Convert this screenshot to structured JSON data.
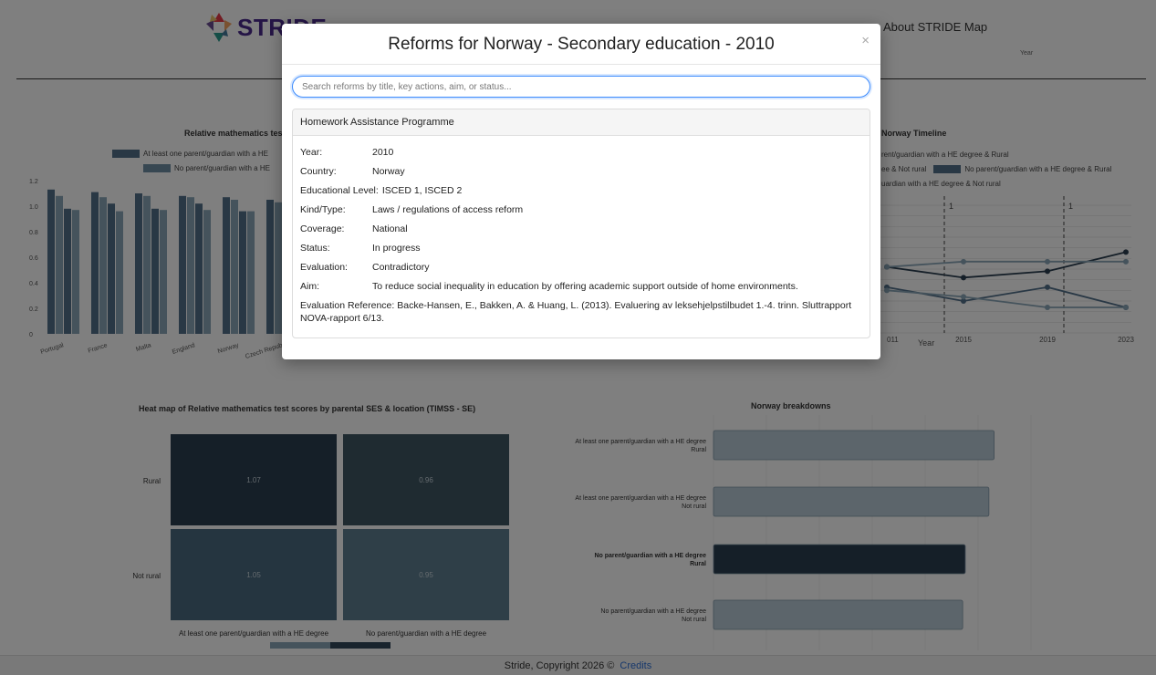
{
  "header": {
    "logo_text": "STRIDE",
    "nav_about": "About STRIDE Map",
    "year_label": "Year"
  },
  "bar_chart": {
    "title": "Relative mathematics test",
    "legend": [
      "At least one parent/guardian with a HE",
      "No parent/guardian with a HE"
    ],
    "yticks": [
      "1.2",
      "1.0",
      "0.8",
      "0.6",
      "0.4",
      "0.2",
      "0"
    ],
    "countries": [
      "Portugal",
      "France",
      "Malta",
      "England",
      "Norway",
      "Czech Repub"
    ]
  },
  "timeline_chart": {
    "title": "Norway Timeline",
    "legend": [
      "rent/guardian with a HE degree & Rural",
      "ee & Not rural",
      "No parent/guardian with a HE degree & Rural",
      "uardian with a HE degree & Not rural"
    ],
    "xticks": [
      "011",
      "2015",
      "2019",
      "2023"
    ],
    "xlabel": "Year",
    "marker_label": "1"
  },
  "heatmap": {
    "title": "Heat map of Relative mathematics test scores by parental SES & location (TIMSS - SE)",
    "rows": [
      "Rural",
      "Not rural"
    ],
    "cols": [
      "At least one parent/guardian with a HE degree",
      "No parent/guardian with a HE degree"
    ],
    "cells": [
      [
        "1.07",
        "0.96"
      ],
      [
        "1.05",
        "0.95"
      ]
    ]
  },
  "breakdowns": {
    "title": "Norway breakdowns",
    "labels": [
      [
        "At least one parent/guardian with a HE degree",
        "Rural"
      ],
      [
        "At least one parent/guardian with a HE degree",
        "Not rural"
      ],
      [
        "No parent/guardian with a HE degree",
        "Rural"
      ],
      [
        "No parent/guardian with a HE degree",
        "Not rural"
      ]
    ]
  },
  "footer": {
    "text": "Stride, Copyright 2026 ©",
    "credits": "Credits"
  },
  "modal": {
    "title": "Reforms for Norway - Secondary education - 2010",
    "close": "×",
    "search_placeholder": "Search reforms by title, key actions, aim, or status...",
    "reform": {
      "title": "Homework Assistance Programme",
      "year_label": "Year:",
      "year": "2010",
      "country_label": "Country:",
      "country": "Norway",
      "level_label": "Educational Level:",
      "level": "ISCED 1, ISCED 2",
      "kind_label": "Kind/Type:",
      "kind": "Laws / regulations of access reform",
      "coverage_label": "Coverage:",
      "coverage": "National",
      "status_label": "Status:",
      "status": "In progress",
      "evaluation_label": "Evaluation:",
      "evaluation": "Contradictory",
      "aim_label": "Aim:",
      "aim": "To reduce social inequality in education by offering academic support outside of home environments.",
      "reference_label": "Evaluation Reference:",
      "reference": "Backe-Hansen, E., Bakken, A. & Huang, L. (2013). Evaluering av leksehjelpstilbudet 1.-4. trinn. Sluttrapport NOVA-rapport 6/13."
    }
  },
  "chart_data": [
    {
      "type": "bar",
      "title": "Relative mathematics test",
      "categories": [
        "Portugal",
        "France",
        "Malta",
        "England",
        "Norway",
        "Czech Repub"
      ],
      "series": [
        {
          "name": "At least one parent/guardian with a HE",
          "values": [
            1.13,
            1.11,
            1.1,
            1.08,
            1.07,
            1.05
          ]
        },
        {
          "name": "",
          "values": [
            1.08,
            1.07,
            1.08,
            1.07,
            1.05,
            1.03
          ]
        },
        {
          "name": "No parent/guardian with a HE",
          "values": [
            0.98,
            1.02,
            0.98,
            1.02,
            0.96,
            0.97
          ]
        },
        {
          "name": "",
          "values": [
            0.97,
            0.96,
            0.97,
            0.97,
            0.96,
            0.96
          ]
        }
      ],
      "ylim": [
        0,
        1.2
      ]
    },
    {
      "type": "line",
      "title": "Norway Timeline",
      "x": [
        2011,
        2015,
        2019,
        2023
      ],
      "series": [
        {
          "values": [
            0.62,
            0.52,
            0.58,
            0.76
          ]
        },
        {
          "values": [
            0.62,
            0.67,
            0.67,
            0.67
          ]
        },
        {
          "values": [
            0.43,
            0.3,
            0.43,
            0.24
          ]
        },
        {
          "values": [
            0.4,
            0.34,
            0.24,
            0.24
          ]
        }
      ],
      "xlabel": "Year",
      "ylim": [
        0,
        1.2
      ]
    },
    {
      "type": "heatmap",
      "title": "Heat map of Relative mathematics test scores by parental SES & location (TIMSS - SE)",
      "rows": [
        "Rural",
        "Not rural"
      ],
      "cols": [
        "At least one parent/guardian with a HE degree",
        "No parent/guardian with a HE degree"
      ],
      "values": [
        [
          1.07,
          0.96
        ],
        [
          1.05,
          0.95
        ]
      ]
    },
    {
      "type": "bar",
      "title": "Norway breakdowns",
      "categories": [
        "At least one parent/guardian with a HE degree Rural",
        "At least one parent/guardian with a HE degree Not rural",
        "No parent/guardian with a HE degree Rural",
        "No parent/guardian with a HE degree Not rural"
      ],
      "values": [
        1.07,
        1.05,
        0.96,
        0.95
      ],
      "xlim": [
        0,
        1.2
      ]
    }
  ],
  "colors": {
    "dark": "#2b3e50",
    "mid": "#52718b",
    "light": "#8aa6b8",
    "pale": "#b6c8d3",
    "accent": "#3d8bfd"
  }
}
